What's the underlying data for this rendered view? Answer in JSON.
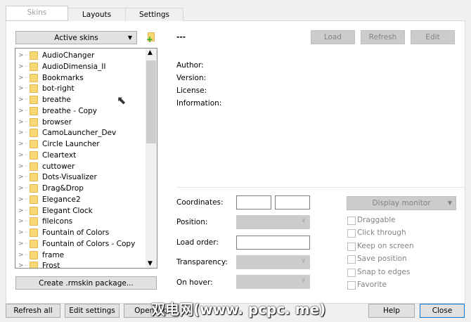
{
  "tabs": [
    "Skins",
    "Layouts",
    "Settings"
  ],
  "skins_dropdown": "Active skins",
  "skin_title": "---",
  "actions": {
    "load": "Load",
    "refresh": "Refresh",
    "edit": "Edit"
  },
  "info_labels": [
    "Author:",
    "Version:",
    "License:",
    "Information:"
  ],
  "skins": [
    "AudioChanger",
    "AudioDimensia_II",
    "Bookmarks",
    "bot-right",
    "breathe",
    "breathe - Copy",
    "browser",
    "CamoLauncher_Dev",
    "Circle Launcher",
    "Cleartext",
    "cuttower",
    "Dots-Visualizer",
    "Drag&Drop",
    "Elegance2",
    "Elegant Clock",
    "fileicons",
    "Fountain of Colors",
    "Fountain of Colors - Copy",
    "frame",
    "Frost"
  ],
  "create_package": "Create .rmskin package...",
  "settings": {
    "coordinates": "Coordinates:",
    "position": "Position:",
    "load_order": "Load order:",
    "transparency": "Transparency:",
    "on_hover": "On hover:",
    "display_monitor": "Display monitor"
  },
  "checkboxes": [
    "Draggable",
    "Click through",
    "Keep on screen",
    "Save position",
    "Snap to edges",
    "Favorite"
  ],
  "bottom": {
    "refresh_all": "Refresh all",
    "edit_settings": "Edit settings",
    "open_log": "Open log",
    "help": "Help",
    "close": "Close"
  },
  "watermark": "双电网(www. pcpc. me)"
}
